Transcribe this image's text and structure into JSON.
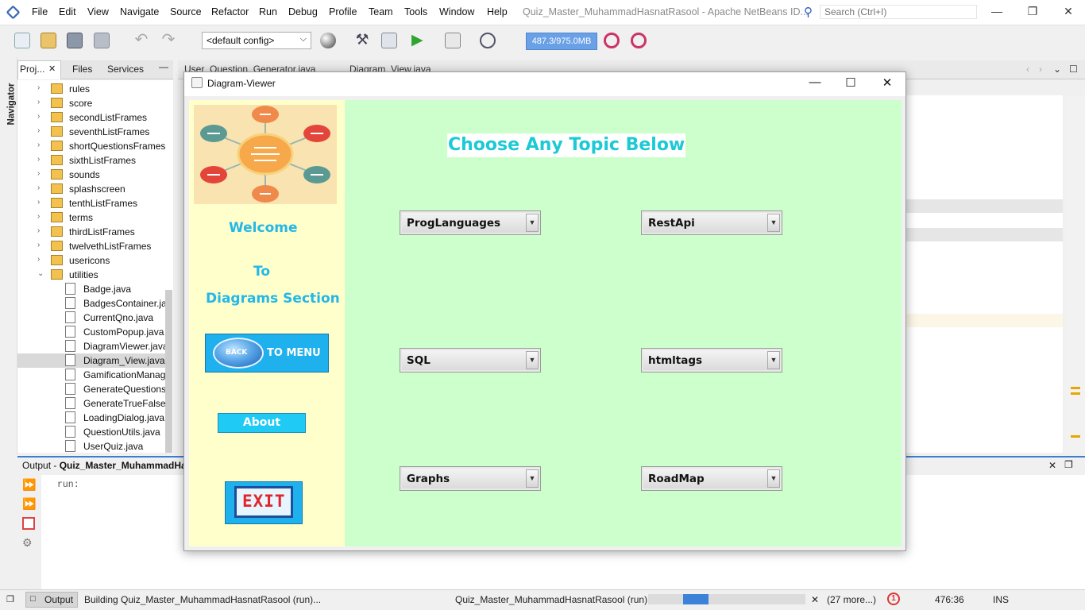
{
  "ide": {
    "window_title": "Quiz_Master_MuhammadHasnatRasool - Apache NetBeans ID...",
    "menu": [
      "File",
      "Edit",
      "View",
      "Navigate",
      "Source",
      "Refactor",
      "Run",
      "Debug",
      "Profile",
      "Team",
      "Tools",
      "Window",
      "Help"
    ],
    "search_placeholder": "Search (Ctrl+I)",
    "config": "<default config>",
    "memory": "487.3/975.0MB",
    "accent_color": "#3b7fd0"
  },
  "navigator_label": "Navigator",
  "project_tabs": [
    "Proj...",
    "Files",
    "Services"
  ],
  "tree": {
    "folders": [
      "rules",
      "score",
      "secondListFrames",
      "seventhListFrames",
      "shortQuestionsFrames",
      "sixthListFrames",
      "sounds",
      "splashscreen",
      "tenthListFrames",
      "terms",
      "thirdListFrames",
      "twelvethListFrames",
      "usericons",
      "utilities"
    ],
    "files": [
      "Badge.java",
      "BadgesContainer.ja",
      "CurrentQno.java",
      "CustomPopup.java",
      "DiagramViewer.java",
      "Diagram_View.java",
      "GamificationManag",
      "GenerateQuestions.",
      "GenerateTrueFalse.j",
      "LoadingDialog.java",
      "QuestionUtils.java",
      "UserQuiz.java"
    ],
    "selected": "Diagram_View.java"
  },
  "editor_tabs": [
    "User_Question_Generator.java",
    "Diagram_View.java"
  ],
  "output": {
    "title_prefix": "Output - ",
    "title_project": "Quiz_Master_MuhammadHa",
    "text": "run:"
  },
  "status": {
    "output_tab": "Output",
    "building": "Building Quiz_Master_MuhammadHasnatRasool (run)...",
    "project": "Quiz_Master_MuhammadHasnatRasool (run)",
    "more": "(27 more...)",
    "position": "476:36",
    "mode": "INS",
    "notification_count": "1"
  },
  "dialog": {
    "title": "Diagram-Viewer",
    "welcome": "Welcome",
    "to": "To",
    "section": "Diagrams Section",
    "back_word": "BACK",
    "back_label": "TO MENU",
    "about": "About",
    "exit": "EXIT",
    "heading": "Choose Any Topic Below",
    "topics": [
      "ProgLanguages",
      "RestApi",
      "SQL",
      "htmltags",
      "Graphs",
      "RoadMap"
    ],
    "colors": {
      "left_panel": "#ffffcc",
      "right_panel": "#ccffcc",
      "heading": "#1cc9d6",
      "side_text": "#22b8e8",
      "button": "#1fb0ee"
    }
  }
}
